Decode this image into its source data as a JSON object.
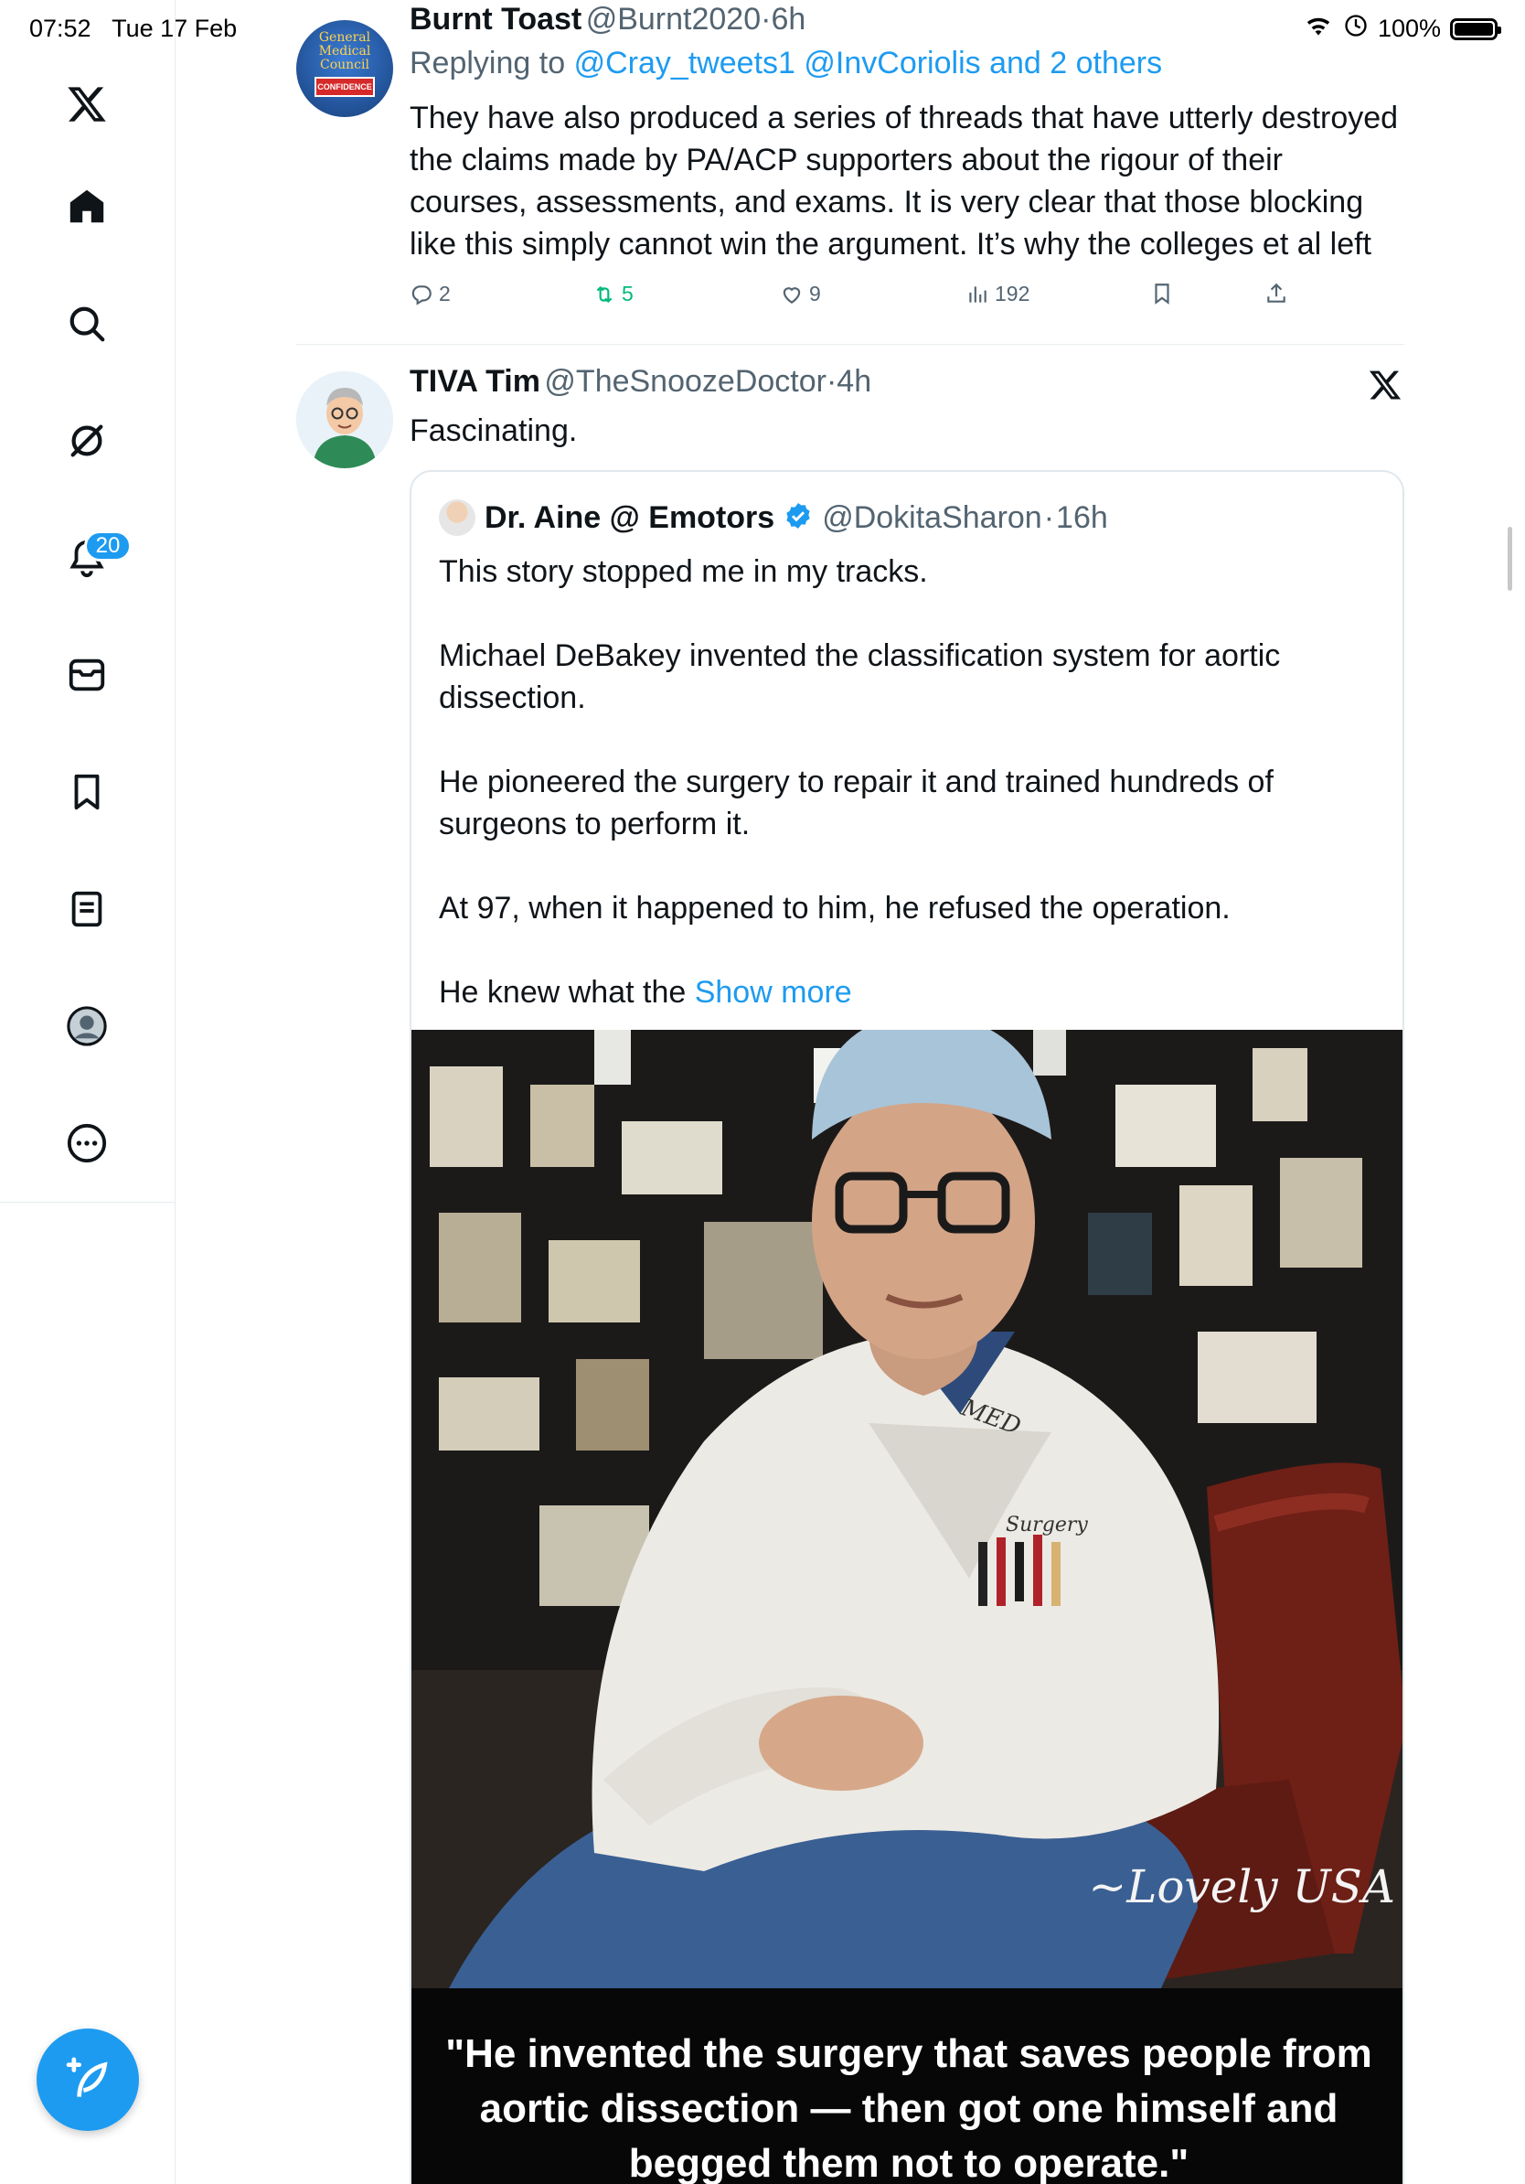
{
  "status_bar": {
    "time": "07:52",
    "date": "Tue 17 Feb",
    "battery": "100%"
  },
  "sidebar": {
    "items": [
      {
        "name": "x-logo-icon"
      },
      {
        "name": "home-icon"
      },
      {
        "name": "search-icon"
      },
      {
        "name": "grok-icon"
      },
      {
        "name": "notifications-icon"
      },
      {
        "name": "messages-icon"
      },
      {
        "name": "bookmarks-icon"
      },
      {
        "name": "lists-icon"
      },
      {
        "name": "profile-icon"
      },
      {
        "name": "more-icon"
      }
    ],
    "notification_count": "20",
    "compose_icon": "compose-icon"
  },
  "tweet1": {
    "name": "Burnt Toast",
    "handle": "@Burnt2020",
    "time": "6h",
    "reply_prefix": "Replying to",
    "reply_targets": "@Cray_tweets1 @InvCoriolis and 2 others",
    "text": "They have also produced a series of threads that have utterly destroyed the claims made by PA/ACP supporters about the rigour of their courses, assessments, and exams. It is very clear that those blocking like this simply cannot win the argument. It’s why the colleges et al left",
    "avatar_text": {
      "line1": "General",
      "line2": "Medical",
      "line3": "Council",
      "badge": "CONFIDENCE"
    },
    "stats": {
      "replies": "2",
      "reposts": "5",
      "likes": "9",
      "views": "192"
    },
    "colors": {
      "repost_active": "#00ba7c"
    }
  },
  "tweet2": {
    "name": "TIVA Tim",
    "handle": "@TheSnoozeDoctor",
    "time": "4h",
    "text": "Fascinating.",
    "quote": {
      "name": "Dr. Aine @ Emotors",
      "handle": "@DokitaSharon",
      "time": "16h",
      "paragraphs": [
        "This story stopped me in my tracks.",
        "Michael DeBakey invented the classification system for aortic dissection.",
        "He pioneered the surgery to repair it and trained hundreds of surgeons to perform it.",
        "At 97, when it happened to him, he refused the operation."
      ],
      "truncated_text": "He knew what the",
      "show_more": "Show more",
      "image": {
        "watermark": "~Lovely USA",
        "coat_monogram": "MED",
        "pocket_text": "Surgery",
        "caption": "\"He invented the surgery that saves people from aortic dissection — then got one himself and begged them not to operate.\""
      }
    }
  },
  "colors": {
    "accent": "#1d9bf0",
    "text_primary": "#0f1419",
    "text_secondary": "#536471"
  }
}
